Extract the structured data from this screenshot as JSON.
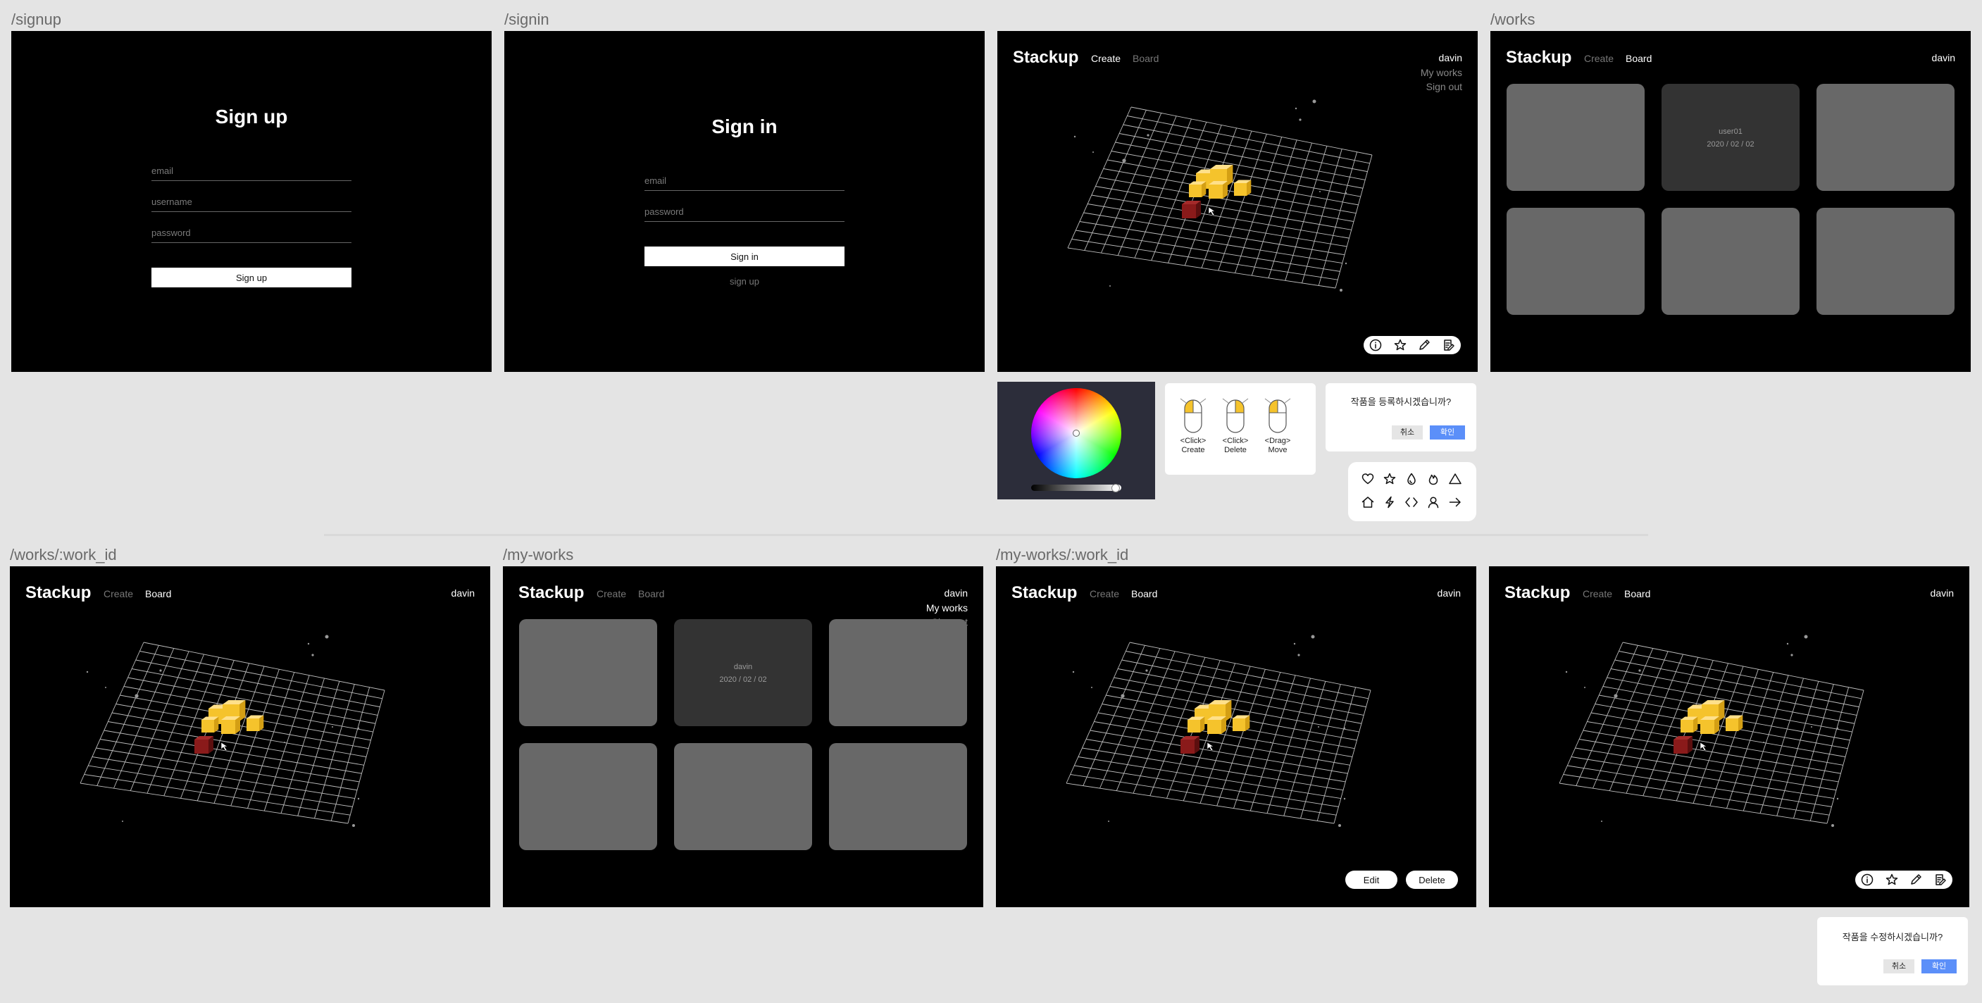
{
  "routes": {
    "signup": "/signup",
    "signin": "/signin",
    "works": "/works",
    "work_detail": "/works/:work_id",
    "my_works": "/my-works",
    "my_work_detail": "/my-works/:work_id"
  },
  "app": {
    "title": "Stackup",
    "nav_create": "Create",
    "nav_board": "Board",
    "username": "davin",
    "menu_my_works": "My works",
    "menu_sign_out": "Sign out"
  },
  "signup": {
    "title": "Sign up",
    "email_placeholder": "email",
    "username_placeholder": "username",
    "password_placeholder": "password",
    "button": "Sign up"
  },
  "signin": {
    "title": "Sign in",
    "email_placeholder": "email",
    "password_placeholder": "password",
    "button": "Sign in",
    "signup_link": "sign up"
  },
  "works_board": {
    "cards": [
      {
        "user": "",
        "date": ""
      },
      {
        "user": "user01",
        "date": "2020 / 02 / 02"
      },
      {
        "user": "",
        "date": ""
      },
      {
        "user": "",
        "date": ""
      },
      {
        "user": "",
        "date": ""
      },
      {
        "user": "",
        "date": ""
      }
    ]
  },
  "my_works_board": {
    "cards": [
      {
        "user": "",
        "date": ""
      },
      {
        "user": "davin",
        "date": "2020 / 02 / 02"
      },
      {
        "user": "",
        "date": ""
      },
      {
        "user": "",
        "date": ""
      },
      {
        "user": "",
        "date": ""
      },
      {
        "user": "",
        "date": ""
      }
    ]
  },
  "toolbar_icons": [
    "info-icon",
    "star-icon",
    "eyedropper-icon",
    "edit-icon"
  ],
  "mouse_help": [
    {
      "action": "<Click>",
      "label": "Create"
    },
    {
      "action": "<Click>",
      "label": "Delete"
    },
    {
      "action": "<Drag>",
      "label": "Move"
    }
  ],
  "register_dialog": {
    "message": "작품을 등록하시겠습니까?",
    "cancel": "취소",
    "confirm": "확인"
  },
  "edit_dialog": {
    "message": "작품을 수정하시겠습니까?",
    "cancel": "취소",
    "confirm": "확인"
  },
  "shape_icons": [
    "heart-icon",
    "star-icon",
    "drop-icon",
    "flame-icon",
    "triangle-icon",
    "house-icon",
    "lightning-icon",
    "diamond-icon",
    "person-icon",
    "arrow-right-icon"
  ],
  "detail_actions": {
    "edit": "Edit",
    "delete": "Delete"
  },
  "colors": {
    "frame_bg": "#000000",
    "canvas_bg": "#e4e4e4",
    "card": "#686868",
    "card_selected": "#333333",
    "accent": "#5b8ff9",
    "block_yellow": "#f5c32c",
    "block_red": "#8a1a1a"
  }
}
